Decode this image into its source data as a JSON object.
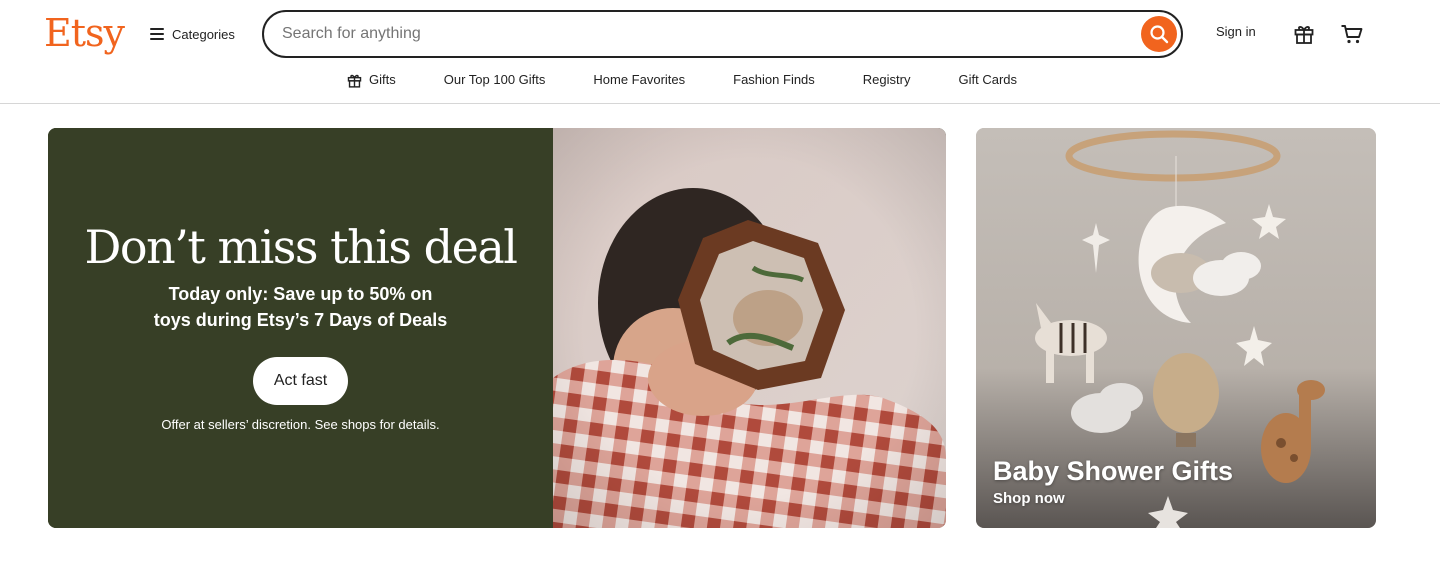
{
  "brand": {
    "logo_text": "Etsy",
    "accent_color": "#f1641e"
  },
  "header": {
    "categories_label": "Categories",
    "search_placeholder": "Search for anything",
    "sign_in_label": "Sign in",
    "icons": {
      "menu": "hamburger-icon",
      "search": "search-icon",
      "gift": "gift-icon",
      "cart": "cart-icon"
    }
  },
  "nav": {
    "items": [
      {
        "label": "Gifts",
        "icon": "gift-icon"
      },
      {
        "label": "Our Top 100 Gifts"
      },
      {
        "label": "Home Favorites"
      },
      {
        "label": "Fashion Finds"
      },
      {
        "label": "Registry"
      },
      {
        "label": "Gift Cards"
      }
    ]
  },
  "hero": {
    "title": "Don’t miss this deal",
    "subtitle_line1": "Today only: Save up to 50% on",
    "subtitle_line2": "toys during Etsy’s 7 Days of Deals",
    "cta_label": "Act fast",
    "note": "Offer at sellers’ discretion. See shops for details.",
    "background_color": "#373f26"
  },
  "side_card": {
    "title": "Baby Shower Gifts",
    "link_label": "Shop now"
  }
}
